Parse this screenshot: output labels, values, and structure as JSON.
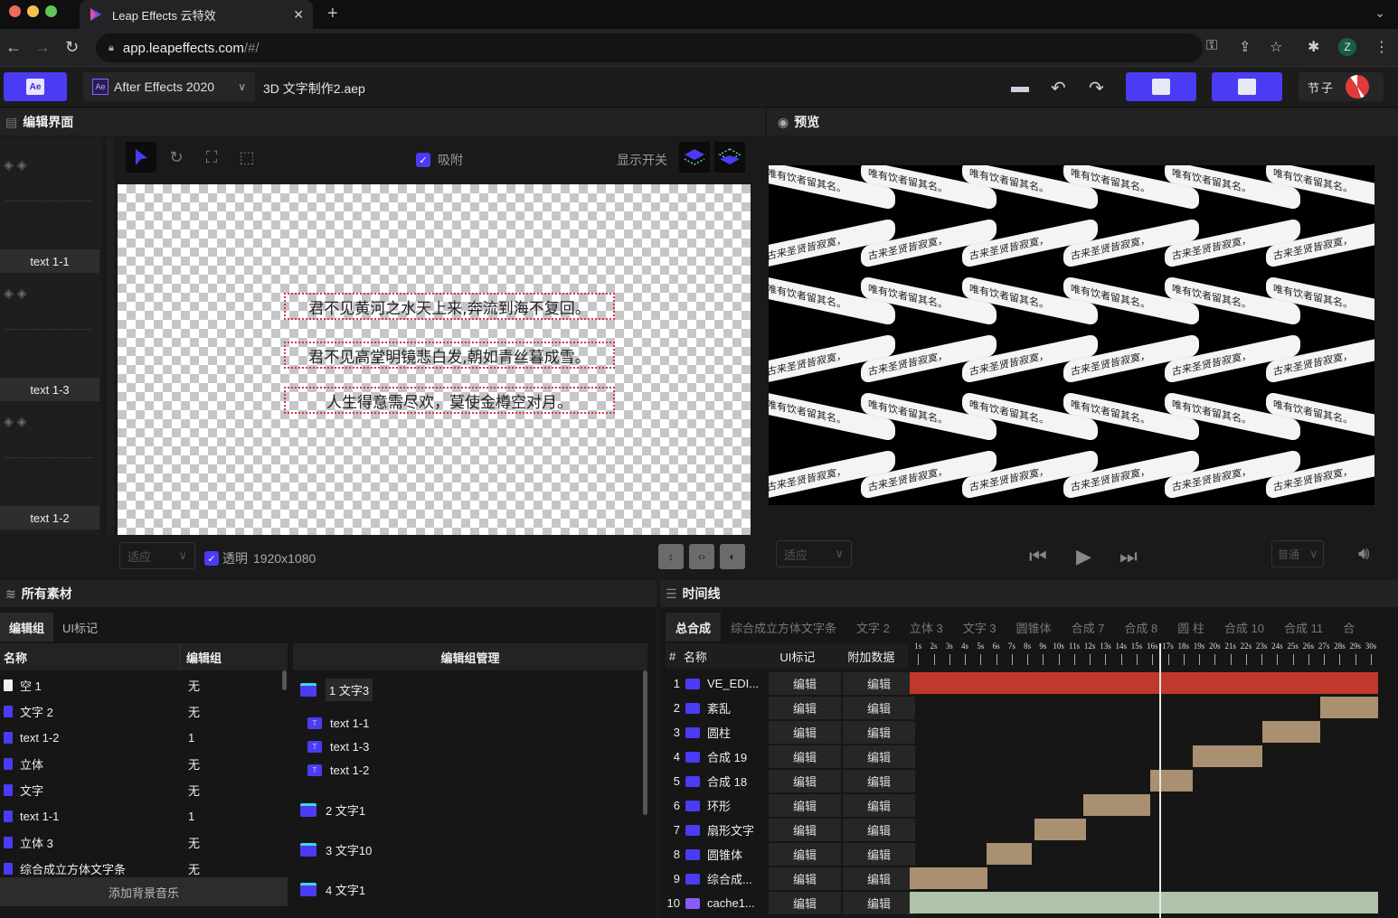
{
  "browser": {
    "tab_title": "Leap Effects 云特效",
    "url_host": "app.leapeffects.com",
    "url_path": "/#/",
    "profile_initial": "Z"
  },
  "header": {
    "app_version": "After Effects 2020",
    "project_name": "3D 文字制作2.aep",
    "user_name": "节子"
  },
  "edit_panel": {
    "title": "编辑界面",
    "snap_label": "吸附",
    "snap_checked": true,
    "display_toggle_label": "显示开关",
    "thumbnails": [
      "text 1-1",
      "text 1-3",
      "text 1-2"
    ],
    "canvas_texts": [
      "君不见黄河之水天上来,奔流到海不复回。",
      "君不见高堂明镜悲白发,朝如青丝暮成雪。",
      "人生得意需尽欢，莫使金樽空对月。"
    ],
    "fit_select": "适应",
    "transparent_label": "透明",
    "transparent_checked": true,
    "resolution": "1920x1080"
  },
  "preview_panel": {
    "title": "预览",
    "ribbon_texts": [
      "唯有饮者留其名。",
      "古来圣贤皆寂寞，"
    ],
    "fit_select": "适应",
    "speed_select": "普通"
  },
  "assets_panel": {
    "title": "所有素材",
    "tabs": [
      "编辑组",
      "UI标记"
    ],
    "active_tab": "编辑组",
    "columns": [
      "名称",
      "编辑组"
    ],
    "rows": [
      {
        "name": "空 1",
        "group": "无",
        "type": "null"
      },
      {
        "name": "文字 2",
        "group": "无",
        "type": "comp"
      },
      {
        "name": "text 1-2",
        "group": "1",
        "type": "text"
      },
      {
        "name": "立体",
        "group": "无",
        "type": "comp"
      },
      {
        "name": "文字",
        "group": "无",
        "type": "comp"
      },
      {
        "name": "text 1-1",
        "group": "1",
        "type": "text"
      },
      {
        "name": "立体 3",
        "group": "无",
        "type": "comp"
      },
      {
        "name": "综合成立方体文字条",
        "group": "无",
        "type": "comp"
      }
    ],
    "add_music_label": "添加背景音乐",
    "group_manager_title": "编辑组管理",
    "groups": [
      {
        "label": "1 文字3",
        "children": [
          "text 1-1",
          "text 1-3",
          "text 1-2"
        ]
      },
      {
        "label": "2 文字1",
        "children": []
      },
      {
        "label": "3 文字10",
        "children": []
      },
      {
        "label": "4 文字1",
        "children": []
      }
    ]
  },
  "timeline_panel": {
    "title": "时间线",
    "comp_tabs": [
      "总合成",
      "综合成立方体文字条",
      "文字 2",
      "立体 3",
      "文字 3",
      "圆锥体",
      "合成 7",
      "合成 8",
      "圆 柱",
      "合成 10",
      "合成 11",
      "合"
    ],
    "active_comp_tab": "总合成",
    "columns": [
      "#",
      "名称",
      "UI标记",
      "附加数据"
    ],
    "ruler_labels": [
      "1s",
      "2s",
      "3s",
      "4s",
      "5s",
      "6s",
      "7s",
      "8s",
      "9s",
      "10s",
      "11s",
      "12s",
      "13s",
      "14s",
      "15s",
      "16s",
      "17s",
      "18s",
      "19s",
      "20s",
      "21s",
      "22s",
      "23s",
      "24s",
      "25s",
      "26s",
      "27s",
      "28s",
      "29s",
      "30s"
    ],
    "duration_seconds": 30,
    "playhead_seconds": 16,
    "edit_label": "编辑",
    "layers": [
      {
        "index": "1",
        "name": "VE_EDI...",
        "type": "text",
        "start": 0,
        "end": 30,
        "color": "#c0392b"
      },
      {
        "index": "2",
        "name": "紊乱",
        "type": "comp",
        "start": 26.3,
        "end": 30,
        "color": "#a99070"
      },
      {
        "index": "3",
        "name": "圆柱",
        "type": "comp",
        "start": 22.6,
        "end": 26.3,
        "color": "#a99070"
      },
      {
        "index": "4",
        "name": "合成 19",
        "type": "comp",
        "start": 18.1,
        "end": 22.6,
        "color": "#a99070"
      },
      {
        "index": "5",
        "name": "合成 18",
        "type": "comp",
        "start": 15.4,
        "end": 18.1,
        "color": "#a99070"
      },
      {
        "index": "6",
        "name": "环形",
        "type": "comp",
        "start": 11.1,
        "end": 15.4,
        "color": "#a99070"
      },
      {
        "index": "7",
        "name": "扇形文字",
        "type": "comp",
        "start": 8.0,
        "end": 11.3,
        "color": "#a99070"
      },
      {
        "index": "8",
        "name": "圆锥体",
        "type": "comp",
        "start": 4.9,
        "end": 7.8,
        "color": "#a99070"
      },
      {
        "index": "9",
        "name": "综合成...",
        "type": "comp",
        "start": 0,
        "end": 5.0,
        "color": "#a99070"
      },
      {
        "index": "10",
        "name": "cache1...",
        "type": "image",
        "start": 0,
        "end": 30,
        "color": "#b1c2ab"
      }
    ]
  },
  "colors": {
    "accent": "#4a3cf5",
    "folder_tab": "#3fd6e8",
    "selection_border": "#d8344a"
  }
}
